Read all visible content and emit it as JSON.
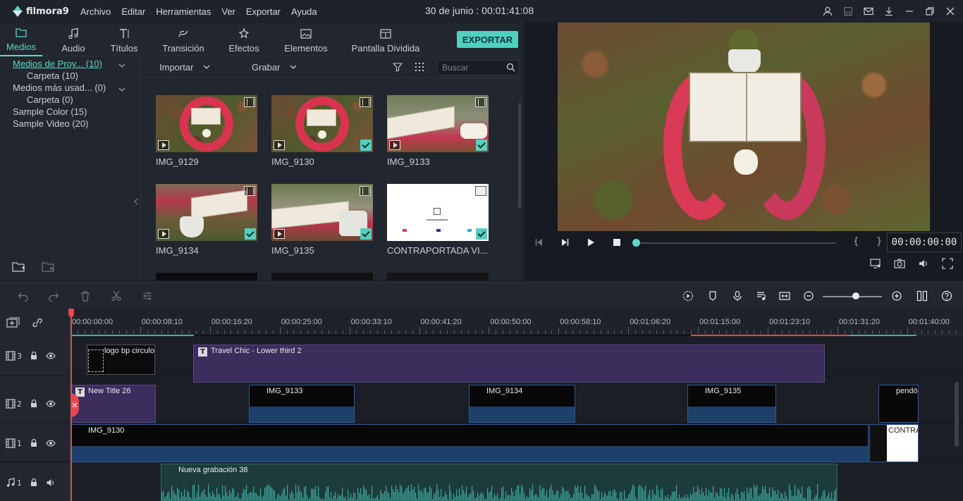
{
  "app": {
    "brand": "filmora9",
    "doc_title": "30 de junio : 00:01:41:08"
  },
  "menu": [
    "Archivo",
    "Editar",
    "Herramientas",
    "Ver",
    "Exportar",
    "Ayuda"
  ],
  "tabs": [
    {
      "label": "Medios",
      "icon": "folder-icon"
    },
    {
      "label": "Audio",
      "icon": "music-note-icon"
    },
    {
      "label": "Títulos",
      "icon": "title-t-icon"
    },
    {
      "label": "Transición",
      "icon": "transition-icon"
    },
    {
      "label": "Efectos",
      "icon": "effects-icon"
    },
    {
      "label": "Elementos",
      "icon": "elements-image-icon"
    },
    {
      "label": "Pantalla Dividida",
      "icon": "split-screen-icon"
    }
  ],
  "export_label": "EXPORTAR",
  "tree": [
    "Medios de Proy... (10)",
    "Carpeta (10)",
    "Medios más usad... (0)",
    "Carpeta (0)",
    "Sample Color (15)",
    "Sample Video (20)"
  ],
  "toolbar": {
    "import": "Importar",
    "record": "Grabar",
    "search_placeholder": "Buscar"
  },
  "media": [
    {
      "name": "IMG_9129"
    },
    {
      "name": "IMG_9130"
    },
    {
      "name": "IMG_9133"
    },
    {
      "name": "IMG_9134"
    },
    {
      "name": "IMG_9135"
    },
    {
      "name": "CONTRAPORTADA VI..."
    }
  ],
  "preview": {
    "timecode": "00:00:00:00",
    "braces": "{ }",
    "progress": 0
  },
  "ruler": [
    "00:00:00:00",
    "00:00:08:10",
    "00:00:16:20",
    "00:00:25:00",
    "00:00:33:10",
    "00:00:41:20",
    "00:00:50:00",
    "00:00:58:10",
    "00:01:06:20",
    "00:01:15:00",
    "00:01:23:10",
    "00:01:31:20",
    "00:01:40:00"
  ],
  "tracks": [
    {
      "num": "3",
      "type": "video"
    },
    {
      "num": "2",
      "type": "video"
    },
    {
      "num": "1",
      "type": "video"
    },
    {
      "num": "1",
      "type": "audio"
    }
  ],
  "clips": {
    "t3_a": "logo bp circulo",
    "t3_b": "Travel Chic - Lower third 2",
    "t2_a": "New Title 26",
    "t2_b": "IMG_9133",
    "t2_c": "IMG_9134",
    "t2_d": "IMG_9135",
    "t2_e": "pendó",
    "t1_a": "IMG_9130",
    "t1_b": "CONTRA",
    "a1_a": "Nueva grabación 38"
  },
  "colors": {
    "accent": "#4fd1c0",
    "playhead": "#e8474f",
    "title_clip": "#3b2d5c",
    "video_clip": "#1f3f6b"
  }
}
